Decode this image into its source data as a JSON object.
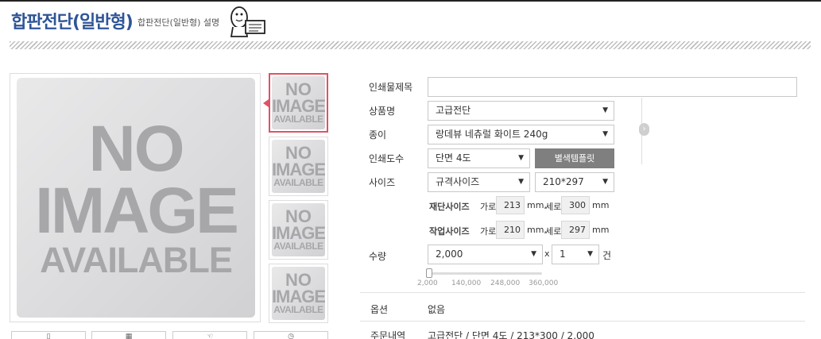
{
  "header": {
    "title": "합판전단(일반형)",
    "subtitle": "합판전단(일반형) 설명"
  },
  "preview": {
    "main_image": [
      "NO",
      "IMAGE",
      "AVAILABLE"
    ],
    "thumb_image": [
      "NO",
      "IMAGE",
      "AVAILABLE"
    ]
  },
  "form": {
    "title_label": "인쇄물제목",
    "title_value": "",
    "product_label": "상품명",
    "product_value": "고급전단",
    "paper_label": "종이",
    "paper_value": "랑데뷰 네츄럴 화이트 240g",
    "color_label": "인쇄도수",
    "color_value": "단면 4도",
    "color_template_button": "별색템플릿",
    "size_label": "사이즈",
    "size_type_value": "규격사이즈",
    "size_value": "210*297",
    "cut_size_label": "재단사이즈",
    "work_size_label": "작업사이즈",
    "width_label": "가로",
    "height_label": "세로",
    "unit_mm_width": "mm,",
    "unit_mm": "mm",
    "cut_width": "213",
    "cut_height": "300",
    "work_width": "210",
    "work_height": "297",
    "qty_label": "수량",
    "qty_value": "2,000",
    "times_symbol": "x",
    "count_value": "1",
    "count_unit": "건",
    "slider_ticks": [
      "2,000",
      "140,000",
      "248,000",
      "360,000"
    ],
    "slider_fraction": 0.0
  },
  "options": {
    "label": "옵션",
    "value": "없음"
  },
  "order": {
    "label": "주문내역",
    "value": "고급전단 / 단면 4도 / 213*300 / 2,000"
  },
  "colors": {
    "title": "#2f5597",
    "thumb_active_border": "#e05266",
    "button_bg": "#7f7f7f"
  }
}
